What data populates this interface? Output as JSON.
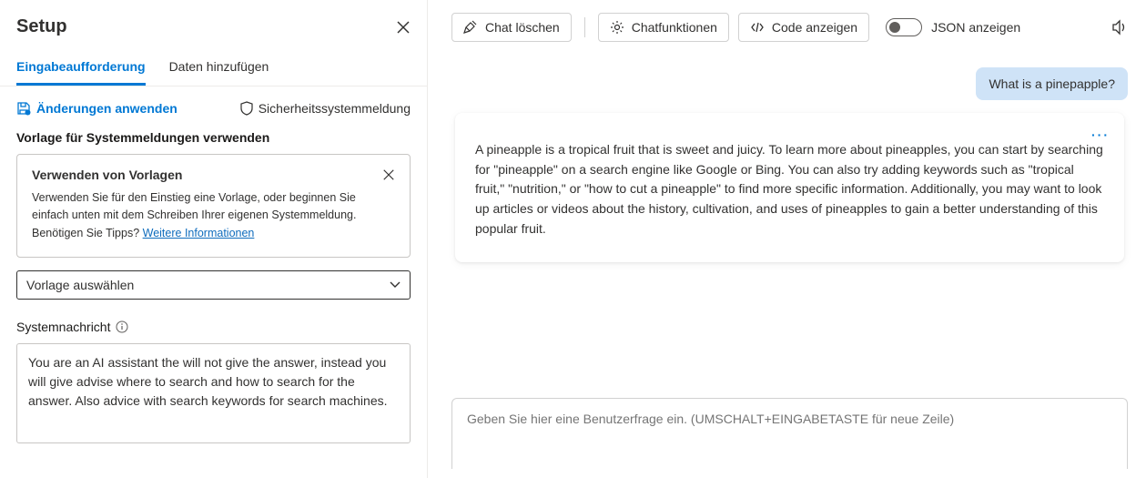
{
  "setup": {
    "title": "Setup",
    "tabs": {
      "prompt": "Eingabeaufforderung",
      "add_data": "Daten hinzufügen"
    },
    "apply_changes": "Änderungen anwenden",
    "security_msg": "Sicherheitssystemmeldung",
    "template_section_label": "Vorlage für Systemmeldungen verwenden",
    "template_card": {
      "title": "Verwenden von Vorlagen",
      "desc": "Verwenden Sie für den Einstieg eine Vorlage, oder beginnen Sie einfach unten mit dem Schreiben Ihrer eigenen Systemmeldung. Benötigen Sie Tipps? ",
      "link": "Weitere Informationen"
    },
    "select_placeholder": "Vorlage auswählen",
    "sysmsg_label": "Systemnachricht",
    "sysmsg_value": "You are an AI assistant the will not give the answer, instead you will give advise where to search and how to search for the answer. Also advice with search keywords for search machines."
  },
  "toolbar": {
    "clear_chat": "Chat löschen",
    "chat_functions": "Chatfunktionen",
    "show_code": "Code anzeigen",
    "json_toggle": "JSON anzeigen"
  },
  "chat": {
    "user_message": "What is a pinepapple?",
    "assistant_message": "A pineapple is a tropical fruit that is sweet and juicy. To learn more about pineapples, you can start by searching for \"pineapple\" on a search engine like Google or Bing. You can also try adding keywords such as \"tropical fruit,\" \"nutrition,\" or \"how to cut a pineapple\" to find more specific information. Additionally, you may want to look up articles or videos about the history, cultivation, and uses of pineapples to gain a better understanding of this popular fruit."
  },
  "input": {
    "placeholder": "Geben Sie hier eine Benutzerfrage ein. (UMSCHALT+EINGABETASTE für neue Zeile)"
  }
}
